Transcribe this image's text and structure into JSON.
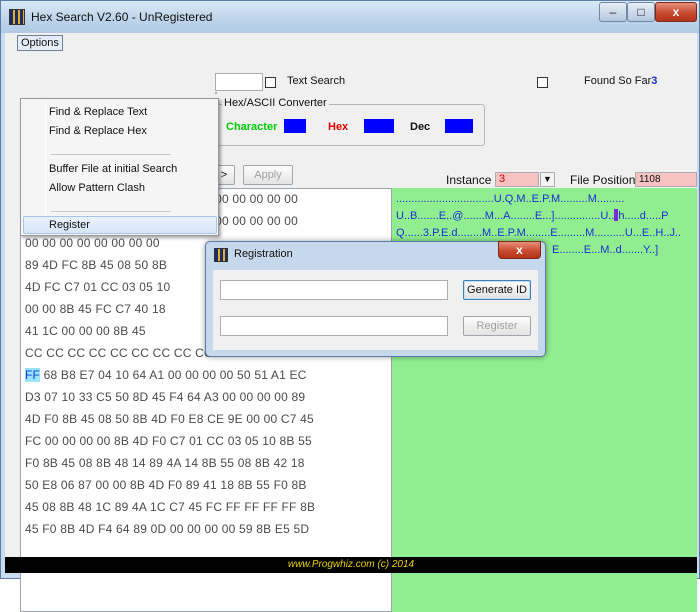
{
  "window": {
    "title": "Hex Search V2.60 - UnRegistered"
  },
  "titlebar_buttons": {
    "minimize": "–",
    "maximize": "□",
    "close": "x"
  },
  "menu": {
    "options_label": "Options",
    "items": [
      "Find & Replace Text",
      "Find & Replace Hex",
      "Buffer File at initial Search",
      "Allow Pattern Clash",
      "Register"
    ]
  },
  "search": {
    "text_search_label": "Text Search",
    "found_label": "Found So Far",
    "found_count": "3"
  },
  "converter": {
    "title": "Hex/ASCII Converter",
    "character_label": "Character",
    "hex_label": "Hex",
    "dec_label": "Dec"
  },
  "toolbar": {
    "next_label": ">",
    "apply_label": "Apply"
  },
  "instance": {
    "label": "Instance",
    "value": "3"
  },
  "file_position": {
    "label": "File Position",
    "value": "1108"
  },
  "hex_rows": [
    "00 00 00 00 00 00 00 00 00 00 00 00 00 00 00 00",
    "00 00 00 00 00 00 00 00 00 00 00 00 00 00 00 00",
    "00 00 00 00 00 00 00 00",
    "89 4D FC 8B 45 08 50 8B",
    "4D FC C7 01 CC 03 05 10",
    "00 00 8B 45 FC C7 40 18",
    "41 1C 00 00 00 8B 45",
    "CC CC CC CC CC CC CC CC CC CC CC CC 55 8B EC 6A",
    "68 B8 E7 04 10 64 A1 00 00 00 00 50 51 A1 EC",
    "D3 07 10 33 C5 50 8D 45 F4 64 A3 00 00 00 00 89",
    "4D F0 8B 45 08 50 8B 4D F0 E8 CE 9E 00 00 C7 45",
    "FC 00 00 00 00 8B 4D F0 C7 01 CC 03 05 10 8B 55",
    "F0 8B 45 08 8B 48 14 89 4A 14 8B 55 08 8B 42 18",
    "50 E8 06 87 00 00 8B 4D F0 89 41 18 8B 55 F0 8B",
    "45 08 8B 48 1C 89 4A 1C C7 45 FC FF FF FF FF 8B",
    "45 F0 8B 4D F4 64 89 0D 00 00 00 00 59 8B E5 5D"
  ],
  "hex_cursor": "FF",
  "ascii_rows": [
    "................................U.Q.M..E.P.M.........M.........",
    "U..B.......E..@.......M...A........E...]...............U..",
    "h.....d.....P",
    "Q......3.P.E.d........M..E.P.M........E.........M..........U...E..H..J..",
    "E........E...M..d.......Y..]"
  ],
  "dialog": {
    "title": "Registration",
    "close": "x",
    "generate_label": "Generate ID",
    "register_label": "Register"
  },
  "footer_text": "www.Progwhiz.com (c) 2014",
  "colors": {
    "found_count": "#1a2fd4",
    "character_label": "#00cc00",
    "hex_label": "#e00000",
    "dec_label": "#111111",
    "ascii_bg": "#90ee90",
    "footer_text": "#f0d000"
  }
}
